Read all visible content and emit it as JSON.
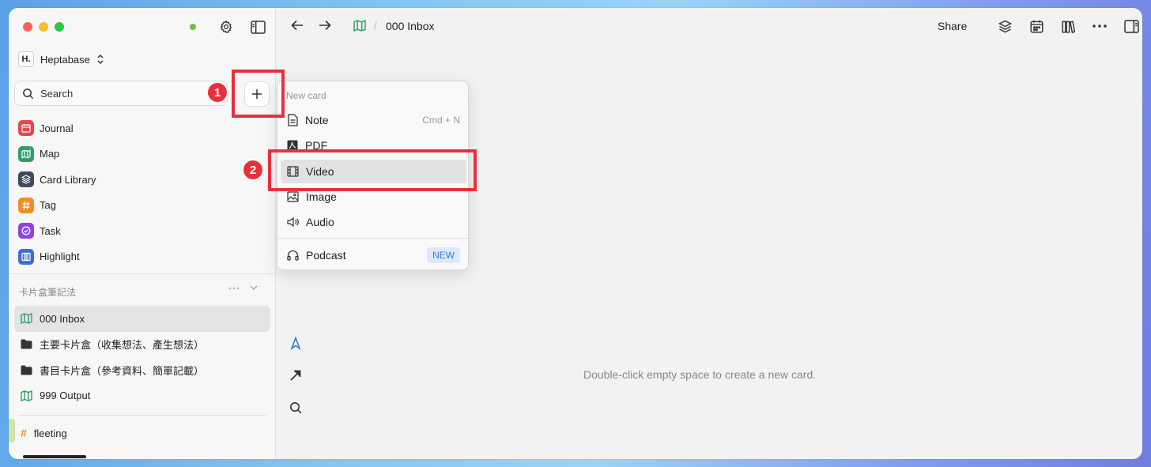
{
  "app": {
    "workspace_logo": "H.",
    "workspace_name": "Heptabase"
  },
  "sidebar": {
    "search_label": "Search",
    "nav_items": [
      {
        "label": "Journal",
        "icon": "calendar-icon",
        "color": "#e5484d"
      },
      {
        "label": "Map",
        "icon": "map-icon",
        "color": "#2e9e6a"
      },
      {
        "label": "Card Library",
        "icon": "layers-icon",
        "color": "#3f4a5a"
      },
      {
        "label": "Tag",
        "icon": "hash-icon",
        "color": "#f08c2a"
      },
      {
        "label": "Task",
        "icon": "check-circle-icon",
        "color": "#8e44e0"
      },
      {
        "label": "Highlight",
        "icon": "highlight-icon",
        "color": "#3a6fd8"
      }
    ],
    "section_title": "卡片盒筆記法",
    "tree": [
      {
        "label": "000 Inbox",
        "icon": "map-icon",
        "active": true
      },
      {
        "label": "主要卡片盒（收集想法、產生想法）",
        "icon": "folder-icon"
      },
      {
        "label": "書目卡片盒（參考資料、簡單記載）",
        "icon": "folder-icon"
      },
      {
        "label": "999 Output",
        "icon": "map-icon"
      }
    ],
    "tag_item": "fleeting"
  },
  "toolbar": {
    "title": "000 Inbox",
    "share_label": "Share"
  },
  "canvas": {
    "empty_message": "Double-click empty space to create a new card."
  },
  "menu": {
    "title": "New card",
    "items": [
      {
        "label": "Note",
        "icon": "note-icon",
        "shortcut": "Cmd + N"
      },
      {
        "label": "PDF",
        "icon": "pdf-icon"
      },
      {
        "label": "Video",
        "icon": "video-icon",
        "highlighted": true
      },
      {
        "label": "Image",
        "icon": "image-icon"
      },
      {
        "label": "Audio",
        "icon": "speaker-icon"
      },
      {
        "label": "Podcast",
        "icon": "headphones-icon",
        "badge": "NEW"
      }
    ]
  },
  "annotations": [
    {
      "number": "1",
      "target": "new-card-button"
    },
    {
      "number": "2",
      "target": "menu-item-video"
    }
  ]
}
